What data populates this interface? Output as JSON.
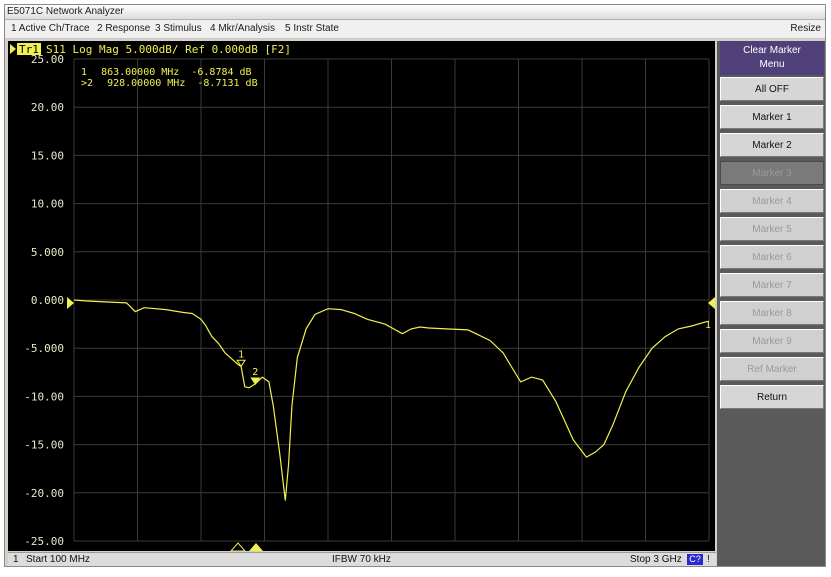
{
  "window": {
    "title": "E5071C Network Analyzer"
  },
  "menu": {
    "items": [
      "1 Active Ch/Trace",
      "2 Response",
      "3 Stimulus",
      "4 Mkr/Analysis",
      "5 Instr State"
    ],
    "resize_label": "Resize"
  },
  "trace": {
    "tag": "Tr1",
    "header": "S11 Log Mag 5.000dB/ Ref 0.000dB [F2]",
    "color": "#f0f050"
  },
  "chart_data": {
    "type": "line",
    "title": "",
    "xlabel": "",
    "ylabel": "",
    "xlim": [
      100,
      3000
    ],
    "ylim": [
      -25,
      25
    ],
    "y_ticks": [
      "25.00",
      "20.00",
      "15.00",
      "10.00",
      "5.000",
      "0.000",
      "-5.000",
      "-10.00",
      "-15.00",
      "-20.00",
      "-25.00"
    ],
    "grid": true,
    "series": [
      {
        "x": [
          100,
          160,
          240,
          340,
          380,
          420,
          520,
          600,
          640,
          680,
          700,
          730,
          760,
          790,
          830,
          850,
          863,
          880,
          900,
          928,
          960,
          990,
          1010,
          1040,
          1065,
          1080,
          1095,
          1120,
          1160,
          1200,
          1260,
          1320,
          1380,
          1440,
          1520,
          1600,
          1640,
          1680,
          1720,
          1800,
          1900,
          2000,
          2060,
          2100,
          2140,
          2190,
          2240,
          2300,
          2340,
          2380,
          2440,
          2480,
          2520,
          2560,
          2620,
          2680,
          2740,
          2800,
          2860,
          2920,
          2980,
          3000
        ],
        "y": [
          0.0,
          -0.1,
          -0.2,
          -0.3,
          -1.2,
          -0.8,
          -1.0,
          -1.3,
          -1.4,
          -2.0,
          -2.6,
          -3.8,
          -4.5,
          -5.5,
          -6.3,
          -6.7,
          -6.9,
          -9.0,
          -9.1,
          -8.7,
          -8.0,
          -8.5,
          -11.0,
          -16.0,
          -20.8,
          -17.0,
          -11.0,
          -6.0,
          -3.0,
          -1.5,
          -0.9,
          -1.0,
          -1.4,
          -2.0,
          -2.5,
          -3.5,
          -3.0,
          -2.8,
          -2.9,
          -3.0,
          -3.1,
          -4.2,
          -5.5,
          -7.0,
          -8.5,
          -8.0,
          -8.3,
          -10.5,
          -12.5,
          -14.5,
          -16.3,
          -15.8,
          -15.0,
          -13.0,
          -9.5,
          -7.0,
          -5.0,
          -3.8,
          -3.0,
          -2.7,
          -2.3,
          -2.2
        ]
      }
    ],
    "markers": [
      {
        "id": "1",
        "x": 863,
        "y": -6.8784
      },
      {
        "id": "2",
        "x": 928,
        "y": -8.7131
      }
    ]
  },
  "marker_readout": [
    {
      "prefix": " 1",
      "freq": "863.00000 MHz",
      "value": "-6.8784 dB"
    },
    {
      "prefix": ">2",
      "freq": "928.00000 MHz",
      "value": "-8.7131 dB"
    }
  ],
  "softkeys": {
    "title_line1": "Clear Marker",
    "title_line2": "Menu",
    "keys": [
      "All OFF",
      "Marker 1",
      "Marker 2",
      "Marker 3",
      "Marker 4",
      "Marker 5",
      "Marker 6",
      "Marker 7",
      "Marker 8",
      "Marker 9",
      "Ref Marker",
      "Return"
    ]
  },
  "status": {
    "channel": "1",
    "start": "Start 100 MHz",
    "ifbw": "IFBW 70 kHz",
    "stop": "Stop 3 GHz",
    "badge": "C?",
    "flag": "!"
  }
}
